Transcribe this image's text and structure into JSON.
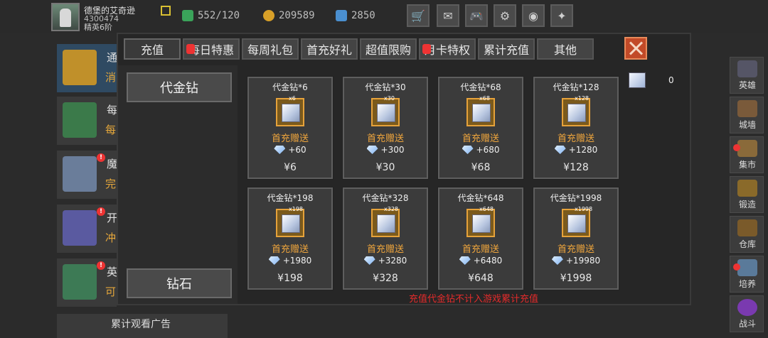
{
  "player": {
    "name": "德堡的艾奇逊",
    "id": "4300474",
    "rank": "精英6阶"
  },
  "resources": [
    {
      "icon": "energy-icon",
      "value": "552/120",
      "color": "#3aa35a"
    },
    {
      "icon": "coin-icon",
      "value": "209589",
      "color": "#d8a028"
    },
    {
      "icon": "gem-icon",
      "value": "2850",
      "color": "#4a8fd0"
    }
  ],
  "top_buttons": [
    {
      "icon": "shop-cart-icon",
      "glyph": "🛒"
    },
    {
      "icon": "mail-icon",
      "glyph": "✉"
    },
    {
      "icon": "gamepad-icon",
      "glyph": "🎮"
    },
    {
      "icon": "settings-gear-icon",
      "glyph": "⚙"
    },
    {
      "icon": "color-wheel-icon",
      "glyph": "◉"
    },
    {
      "icon": "sparkle-icon",
      "glyph": "✦"
    }
  ],
  "background_list": [
    {
      "t1": "通",
      "t2": "消",
      "color": "#c0902a",
      "badge": false
    },
    {
      "t1": "每",
      "t2": "每",
      "color": "#3b7a4a",
      "badge": false
    },
    {
      "t1": "魔",
      "t2": "完",
      "color": "#6a7d9a",
      "badge": true
    },
    {
      "t1": "开",
      "t2": "冲",
      "color": "#5a5aa0",
      "badge": true
    },
    {
      "t1": "英",
      "t2": "可",
      "color": "#3d7a55",
      "badge": true
    }
  ],
  "background_footer": "累计观看广告",
  "right_nav": [
    {
      "label": "英雄",
      "icon": "hero-helmet-icon",
      "color": "#556",
      "badge": false
    },
    {
      "label": "城墙",
      "icon": "wall-icon",
      "color": "#7a5a3a",
      "badge": false
    },
    {
      "label": "集市",
      "icon": "market-icon",
      "color": "#8a6a3a",
      "badge": true
    },
    {
      "label": "锻造",
      "icon": "anvil-icon",
      "color": "#8a6a2a",
      "badge": false
    },
    {
      "label": "仓库",
      "icon": "warehouse-icon",
      "color": "#7a5a2a",
      "badge": false
    },
    {
      "label": "培养",
      "icon": "trophy-icon",
      "color": "#5a7a9a",
      "badge": true
    },
    {
      "label": "战斗",
      "icon": "portal-icon",
      "color": "#7a3ab0",
      "badge": false
    }
  ],
  "tabs": [
    {
      "label": "充值",
      "active": true,
      "badge": false
    },
    {
      "label": "每日特惠",
      "active": false,
      "badge": true
    },
    {
      "label": "每周礼包",
      "active": false,
      "badge": false
    },
    {
      "label": "首充好礼",
      "active": false,
      "badge": false
    },
    {
      "label": "超值限购",
      "active": false,
      "badge": false
    },
    {
      "label": "月卡特权",
      "active": false,
      "badge": true
    },
    {
      "label": "累计充值",
      "active": false,
      "badge": false
    },
    {
      "label": "其他",
      "active": false,
      "badge": false
    }
  ],
  "side_buttons": [
    "代金钻",
    "钻石"
  ],
  "balance": "0",
  "cards": [
    {
      "title": "代金钻*6",
      "tag": "x6",
      "bonus": "首充赠送",
      "reward": "+60",
      "price": "¥6"
    },
    {
      "title": "代金钻*30",
      "tag": "x30",
      "bonus": "首充赠送",
      "reward": "+300",
      "price": "¥30"
    },
    {
      "title": "代金钻*68",
      "tag": "x68",
      "bonus": "首充赠送",
      "reward": "+680",
      "price": "¥68"
    },
    {
      "title": "代金钻*128",
      "tag": "x128",
      "bonus": "首充赠送",
      "reward": "+1280",
      "price": "¥128"
    },
    {
      "title": "代金钻*198",
      "tag": "x198",
      "bonus": "首充赠送",
      "reward": "+1980",
      "price": "¥198"
    },
    {
      "title": "代金钻*328",
      "tag": "x328",
      "bonus": "首充赠送",
      "reward": "+3280",
      "price": "¥328"
    },
    {
      "title": "代金钻*648",
      "tag": "x648",
      "bonus": "首充赠送",
      "reward": "+6480",
      "price": "¥648"
    },
    {
      "title": "代金钻*1998",
      "tag": "x1998",
      "bonus": "首充赠送",
      "reward": "+19980",
      "price": "¥1998"
    }
  ],
  "notice": "充值代金钻不计入游戏累计充值"
}
